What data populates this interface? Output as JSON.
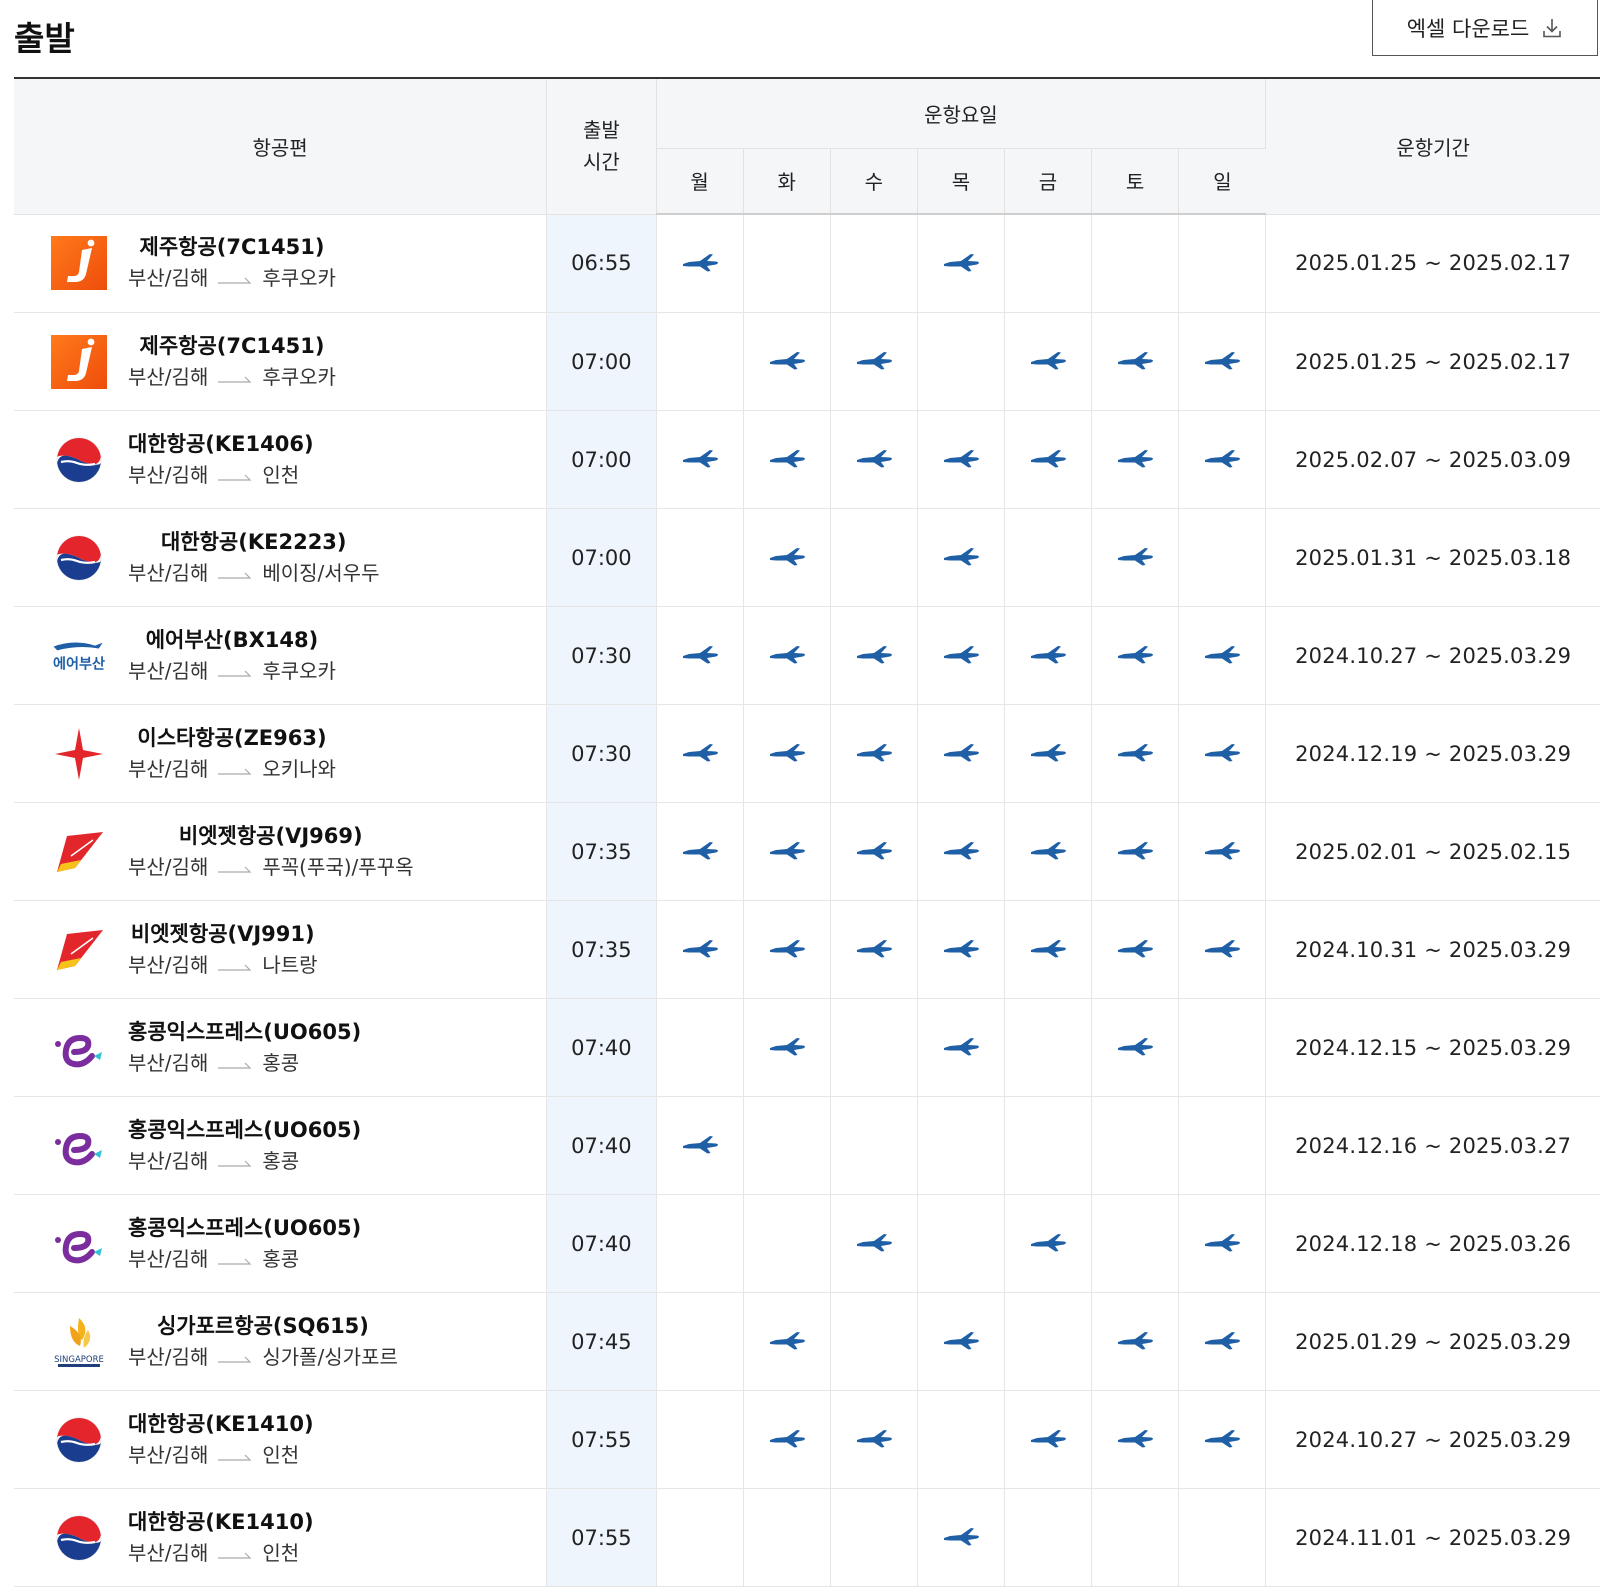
{
  "page": {
    "title": "출발",
    "excel_button": "엑셀 다운로드"
  },
  "colors": {
    "plane": "#1f5fa6",
    "time_bg": "#eef5fd",
    "header_bg": "#f5f6f8"
  },
  "table": {
    "headers": {
      "flight": "항공편",
      "time_line1": "출발",
      "time_line2": "시간",
      "days_group": "운항요일",
      "period": "운항기간"
    },
    "days": [
      "월",
      "화",
      "수",
      "목",
      "금",
      "토",
      "일"
    ],
    "rows": [
      {
        "logo": "jejuair-logo",
        "flight": "제주항공(7C1451)",
        "from": "부산/김해",
        "to": "후쿠오카",
        "time": "06:55",
        "days": [
          1,
          0,
          0,
          1,
          0,
          0,
          0
        ],
        "period": "2025.01.25 ~ 2025.02.17"
      },
      {
        "logo": "jejuair-logo",
        "flight": "제주항공(7C1451)",
        "from": "부산/김해",
        "to": "후쿠오카",
        "time": "07:00",
        "days": [
          0,
          1,
          1,
          0,
          1,
          1,
          1
        ],
        "period": "2025.01.25 ~ 2025.02.17"
      },
      {
        "logo": "koreanair-logo",
        "flight": "대한항공(KE1406)",
        "from": "부산/김해",
        "to": "인천",
        "time": "07:00",
        "days": [
          1,
          1,
          1,
          1,
          1,
          1,
          1
        ],
        "period": "2025.02.07 ~ 2025.03.09"
      },
      {
        "logo": "koreanair-logo",
        "flight": "대한항공(KE2223)",
        "from": "부산/김해",
        "to": "베이징/서우두",
        "time": "07:00",
        "days": [
          0,
          1,
          0,
          1,
          0,
          1,
          0
        ],
        "period": "2025.01.31 ~ 2025.03.18"
      },
      {
        "logo": "airbusan-logo",
        "logo_text": "에어부산",
        "flight": "에어부산(BX148)",
        "from": "부산/김해",
        "to": "후쿠오카",
        "time": "07:30",
        "days": [
          1,
          1,
          1,
          1,
          1,
          1,
          1
        ],
        "period": "2024.10.27 ~ 2025.03.29"
      },
      {
        "logo": "eastarjet-logo",
        "flight": "이스타항공(ZE963)",
        "from": "부산/김해",
        "to": "오키나와",
        "time": "07:30",
        "days": [
          1,
          1,
          1,
          1,
          1,
          1,
          1
        ],
        "period": "2024.12.19 ~ 2025.03.29"
      },
      {
        "logo": "vietjet-logo",
        "flight": "비엣젯항공(VJ969)",
        "from": "부산/김해",
        "to": "푸꼭(푸국)/푸꾸옥",
        "time": "07:35",
        "days": [
          1,
          1,
          1,
          1,
          1,
          1,
          1
        ],
        "period": "2025.02.01 ~ 2025.02.15"
      },
      {
        "logo": "vietjet-logo",
        "flight": "비엣젯항공(VJ991)",
        "from": "부산/김해",
        "to": "나트랑",
        "time": "07:35",
        "days": [
          1,
          1,
          1,
          1,
          1,
          1,
          1
        ],
        "period": "2024.10.31 ~ 2025.03.29"
      },
      {
        "logo": "hkexpress-logo",
        "flight": "홍콩익스프레스(UO605)",
        "from": "부산/김해",
        "to": "홍콩",
        "time": "07:40",
        "days": [
          0,
          1,
          0,
          1,
          0,
          1,
          0
        ],
        "period": "2024.12.15 ~ 2025.03.29"
      },
      {
        "logo": "hkexpress-logo",
        "flight": "홍콩익스프레스(UO605)",
        "from": "부산/김해",
        "to": "홍콩",
        "time": "07:40",
        "days": [
          1,
          0,
          0,
          0,
          0,
          0,
          0
        ],
        "period": "2024.12.16 ~ 2025.03.27"
      },
      {
        "logo": "hkexpress-logo",
        "flight": "홍콩익스프레스(UO605)",
        "from": "부산/김해",
        "to": "홍콩",
        "time": "07:40",
        "days": [
          0,
          0,
          1,
          0,
          1,
          0,
          1
        ],
        "period": "2024.12.18 ~ 2025.03.26"
      },
      {
        "logo": "singapore-airlines-logo",
        "flight": "싱가포르항공(SQ615)",
        "from": "부산/김해",
        "to": "싱가폴/싱가포르",
        "time": "07:45",
        "days": [
          0,
          1,
          0,
          1,
          0,
          1,
          1
        ],
        "period": "2025.01.29 ~ 2025.03.29"
      },
      {
        "logo": "koreanair-logo",
        "flight": "대한항공(KE1410)",
        "from": "부산/김해",
        "to": "인천",
        "time": "07:55",
        "days": [
          0,
          1,
          1,
          0,
          1,
          1,
          1
        ],
        "period": "2024.10.27 ~ 2025.03.29"
      },
      {
        "logo": "koreanair-logo",
        "flight": "대한항공(KE1410)",
        "from": "부산/김해",
        "to": "인천",
        "time": "07:55",
        "days": [
          0,
          0,
          0,
          1,
          0,
          0,
          0
        ],
        "period": "2024.11.01 ~ 2025.03.29"
      }
    ]
  }
}
